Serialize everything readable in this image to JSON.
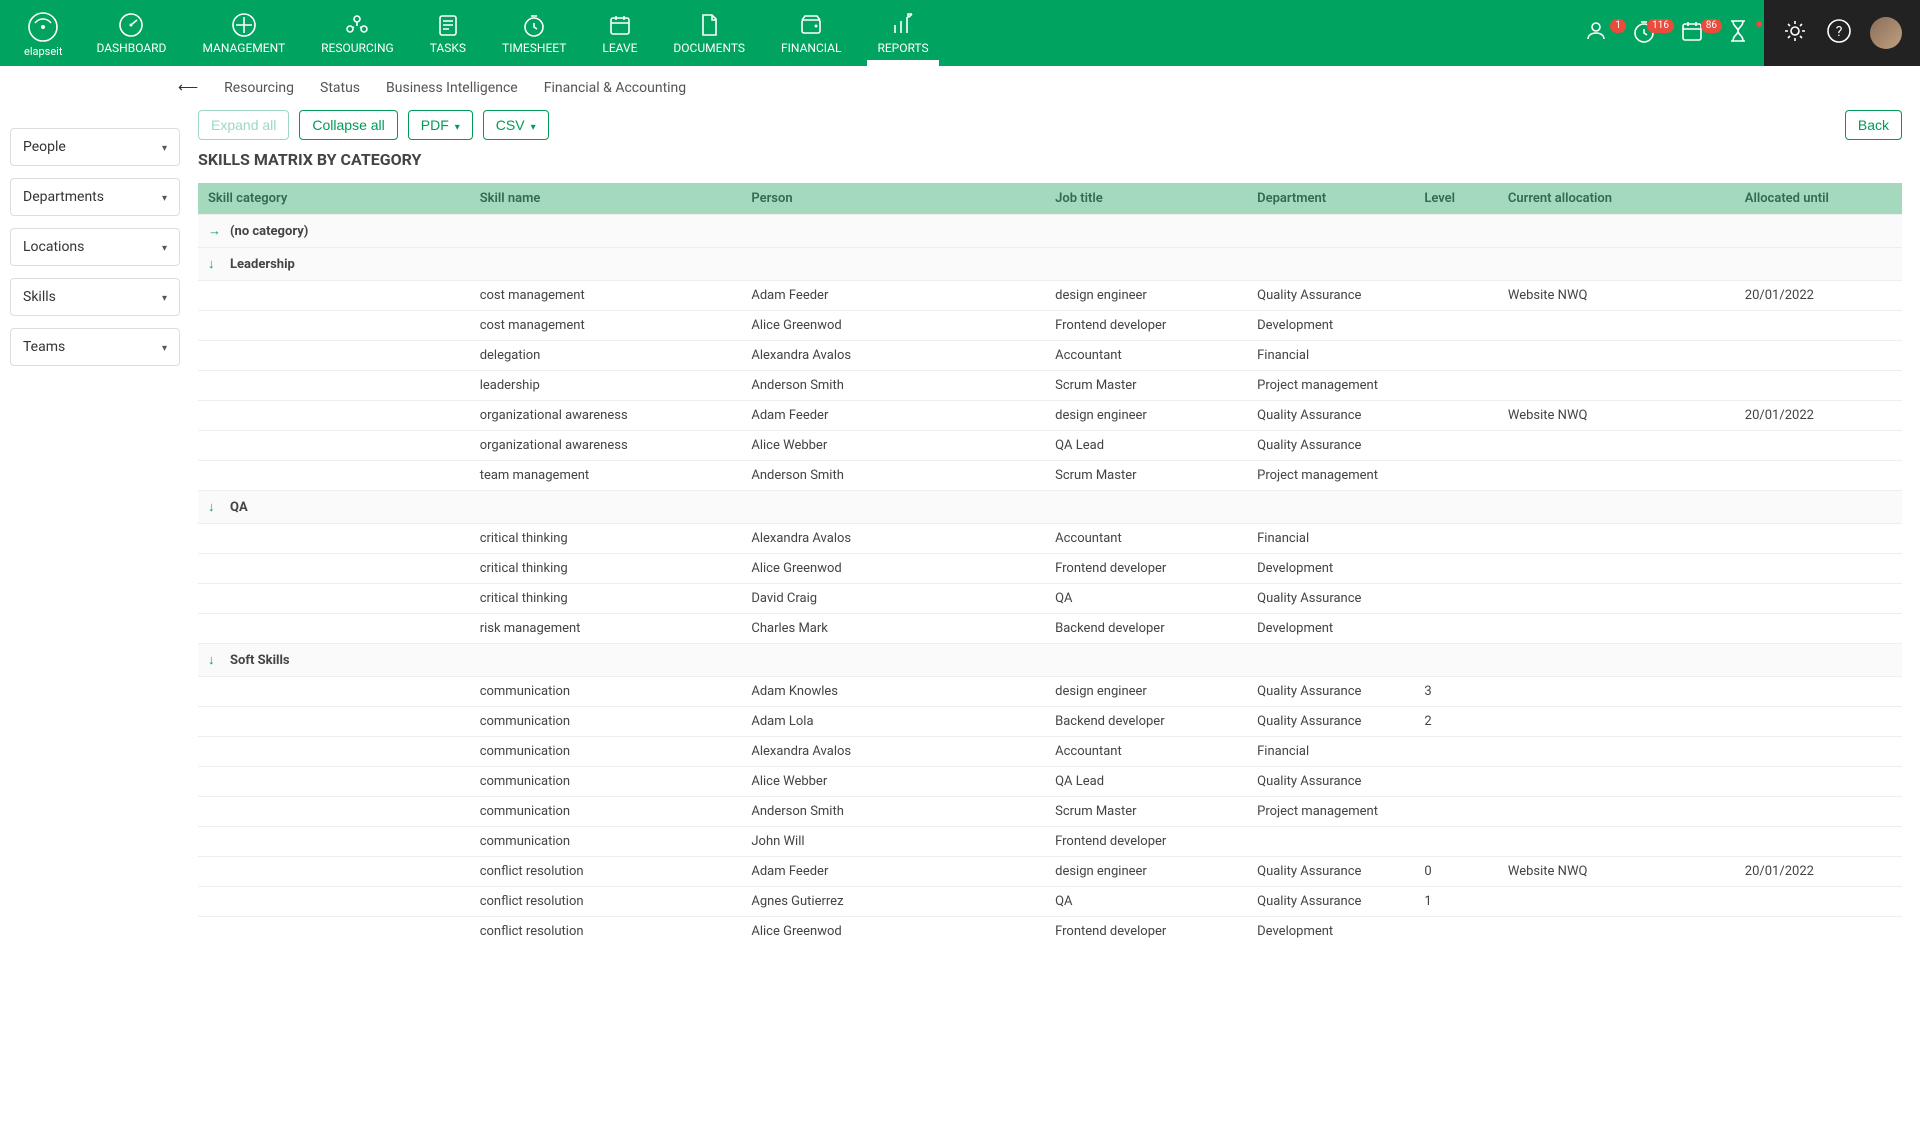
{
  "brand": "elapseit",
  "nav": {
    "items": [
      {
        "label": "DASHBOARD"
      },
      {
        "label": "MANAGEMENT"
      },
      {
        "label": "RESOURCING"
      },
      {
        "label": "TASKS"
      },
      {
        "label": "TIMESHEET"
      },
      {
        "label": "LEAVE"
      },
      {
        "label": "DOCUMENTS"
      },
      {
        "label": "FINANCIAL"
      },
      {
        "label": "REPORTS"
      }
    ]
  },
  "badges": {
    "b1": "1",
    "b2": "116",
    "b3": "86"
  },
  "subtabs": {
    "t1": "Resourcing",
    "t2": "Status",
    "t3": "Business Intelligence",
    "t4": "Financial & Accounting"
  },
  "filters": {
    "f1": "People",
    "f2": "Departments",
    "f3": "Locations",
    "f4": "Skills",
    "f5": "Teams"
  },
  "toolbar": {
    "expand": "Expand all",
    "collapse": "Collapse all",
    "pdf": "PDF",
    "csv": "CSV",
    "back": "Back"
  },
  "pageTitle": "SKILLS MATRIX BY CATEGORY",
  "columns": {
    "c1": "Skill category",
    "c2": "Skill name",
    "c3": "Person",
    "c4": "Job title",
    "c5": "Department",
    "c6": "Level",
    "c7": "Current allocation",
    "c8": "Allocated until"
  },
  "groups": [
    {
      "name": "(no category)",
      "expanded": false,
      "rows": []
    },
    {
      "name": "Leadership",
      "expanded": true,
      "rows": [
        {
          "skill": "cost management",
          "person": "Adam Feeder",
          "job": "design engineer",
          "dept": "Quality Assurance",
          "level": "",
          "alloc": "Website NWQ",
          "until": "20/01/2022"
        },
        {
          "skill": "cost management",
          "person": "Alice Greenwod",
          "job": "Frontend developer",
          "dept": "Development",
          "level": "",
          "alloc": "",
          "until": ""
        },
        {
          "skill": "delegation",
          "person": "Alexandra Avalos",
          "job": "Accountant",
          "dept": "Financial",
          "level": "",
          "alloc": "",
          "until": ""
        },
        {
          "skill": "leadership",
          "person": "Anderson Smith",
          "job": "Scrum Master",
          "dept": "Project management",
          "level": "",
          "alloc": "",
          "until": ""
        },
        {
          "skill": "organizational awareness",
          "person": "Adam Feeder",
          "job": "design engineer",
          "dept": "Quality Assurance",
          "level": "",
          "alloc": "Website NWQ",
          "until": "20/01/2022"
        },
        {
          "skill": "organizational awareness",
          "person": "Alice Webber",
          "job": "QA Lead",
          "dept": "Quality Assurance",
          "level": "",
          "alloc": "",
          "until": ""
        },
        {
          "skill": "team management",
          "person": "Anderson Smith",
          "job": "Scrum Master",
          "dept": "Project management",
          "level": "",
          "alloc": "",
          "until": ""
        }
      ]
    },
    {
      "name": "QA",
      "expanded": true,
      "rows": [
        {
          "skill": "critical thinking",
          "person": "Alexandra Avalos",
          "job": "Accountant",
          "dept": "Financial",
          "level": "",
          "alloc": "",
          "until": ""
        },
        {
          "skill": "critical thinking",
          "person": "Alice Greenwod",
          "job": "Frontend developer",
          "dept": "Development",
          "level": "",
          "alloc": "",
          "until": ""
        },
        {
          "skill": "critical thinking",
          "person": "David Craig",
          "job": "QA",
          "dept": "Quality Assurance",
          "level": "",
          "alloc": "",
          "until": ""
        },
        {
          "skill": "risk management",
          "person": "Charles Mark",
          "job": "Backend developer",
          "dept": "Development",
          "level": "",
          "alloc": "",
          "until": ""
        }
      ]
    },
    {
      "name": "Soft Skills",
      "expanded": true,
      "rows": [
        {
          "skill": "communication",
          "person": "Adam Knowles",
          "job": "design engineer",
          "dept": "Quality Assurance",
          "level": "3",
          "alloc": "",
          "until": ""
        },
        {
          "skill": "communication",
          "person": "Adam Lola",
          "job": "Backend developer",
          "dept": "Quality Assurance",
          "level": "2",
          "alloc": "",
          "until": ""
        },
        {
          "skill": "communication",
          "person": "Alexandra Avalos",
          "job": "Accountant",
          "dept": "Financial",
          "level": "",
          "alloc": "",
          "until": ""
        },
        {
          "skill": "communication",
          "person": "Alice Webber",
          "job": "QA Lead",
          "dept": "Quality Assurance",
          "level": "",
          "alloc": "",
          "until": ""
        },
        {
          "skill": "communication",
          "person": "Anderson Smith",
          "job": "Scrum Master",
          "dept": "Project management",
          "level": "",
          "alloc": "",
          "until": ""
        },
        {
          "skill": "communication",
          "person": "John Will",
          "job": "Frontend developer",
          "dept": "",
          "level": "",
          "alloc": "",
          "until": ""
        },
        {
          "skill": "conflict resolution",
          "person": "Adam Feeder",
          "job": "design engineer",
          "dept": "Quality Assurance",
          "level": "0",
          "alloc": "Website NWQ",
          "until": "20/01/2022"
        },
        {
          "skill": "conflict resolution",
          "person": "Agnes Gutierrez",
          "job": "QA",
          "dept": "Quality Assurance",
          "level": "1",
          "alloc": "",
          "until": ""
        },
        {
          "skill": "conflict resolution",
          "person": "Alice Greenwod",
          "job": "Frontend developer",
          "dept": "Development",
          "level": "",
          "alloc": "",
          "until": ""
        }
      ]
    }
  ]
}
